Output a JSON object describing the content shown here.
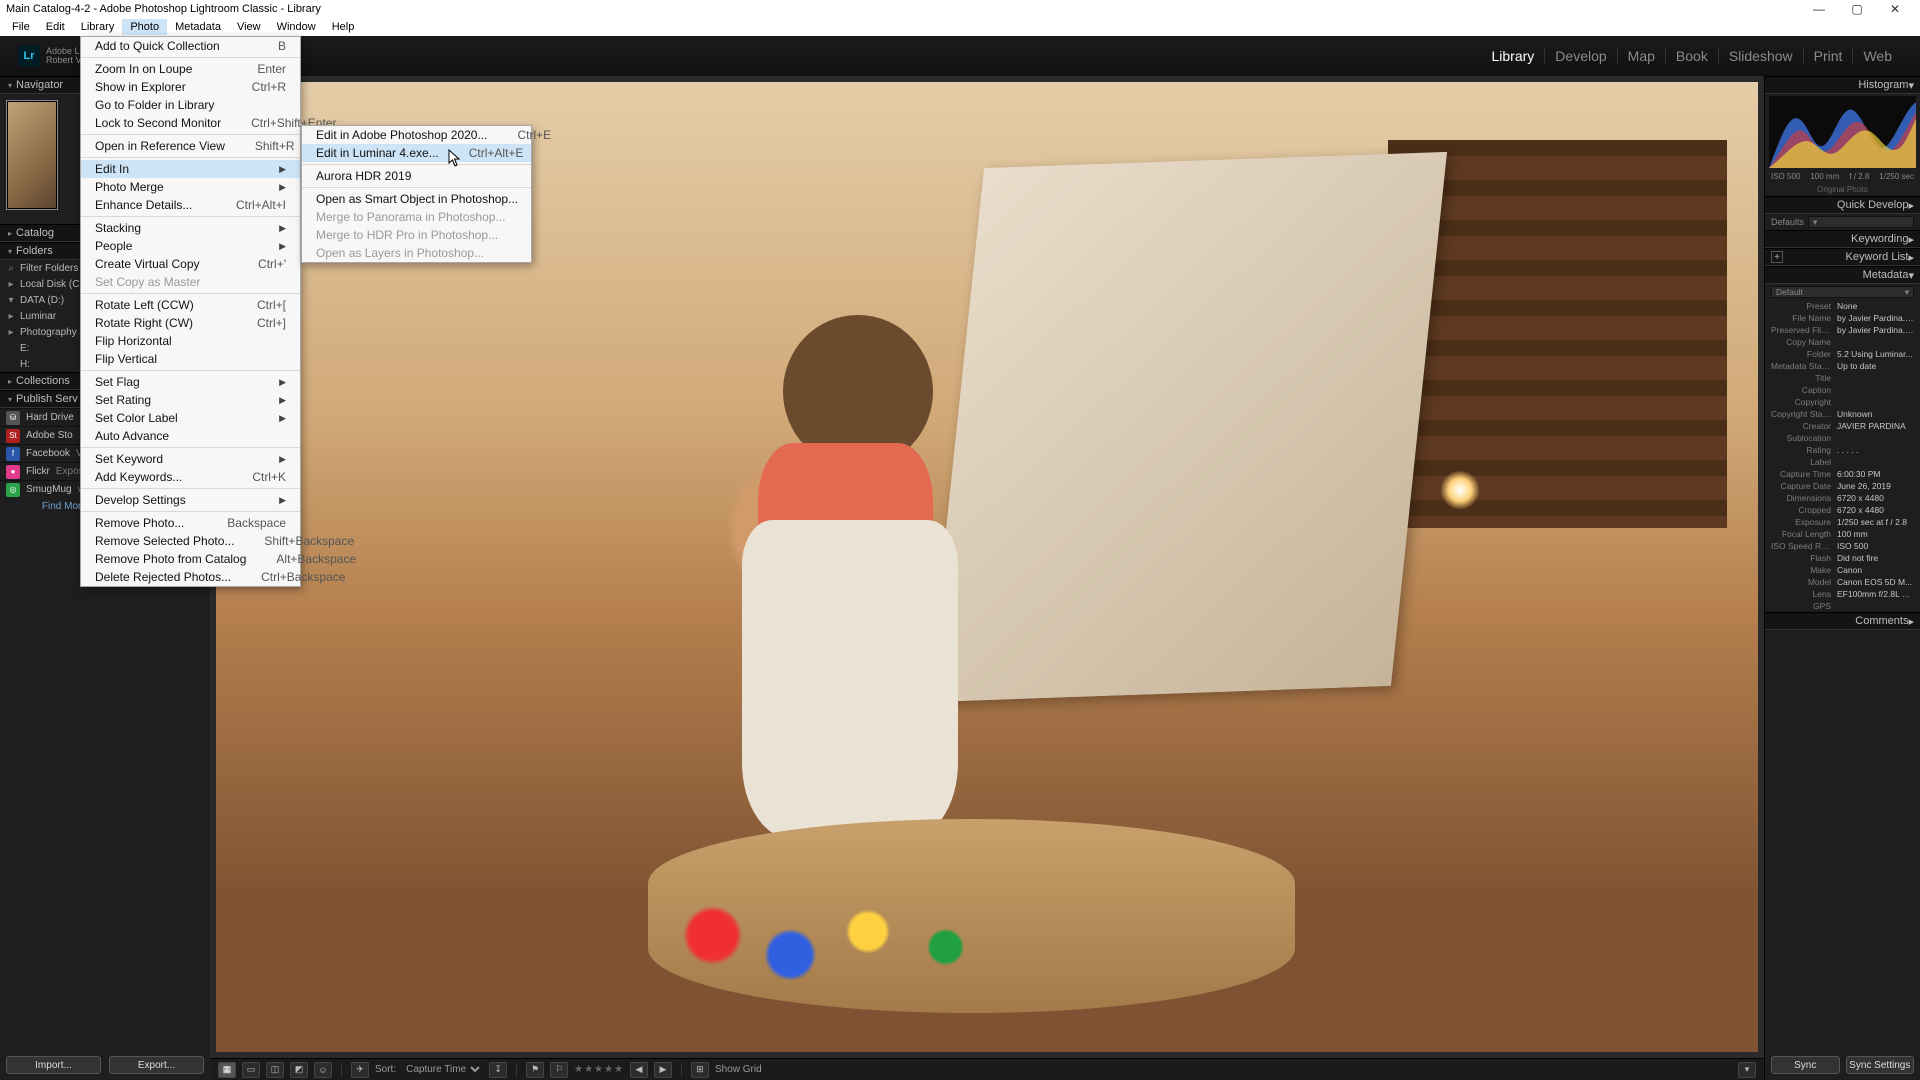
{
  "window": {
    "title": "Main Catalog-4-2 - Adobe Photoshop Lightroom Classic - Library"
  },
  "menubar": [
    "File",
    "Edit",
    "Library",
    "Photo",
    "Metadata",
    "View",
    "Window",
    "Help"
  ],
  "menubar_active_index": 3,
  "modulepicker": {
    "product_top": "Adobe Lightroom",
    "product_bottom": "Robert Va",
    "modules": [
      "Library",
      "Develop",
      "Map",
      "Book",
      "Slideshow",
      "Print",
      "Web"
    ],
    "active": "Library"
  },
  "left": {
    "navigator": {
      "title": "Navigator"
    },
    "catalog": {
      "title": "Catalog"
    },
    "folders": {
      "title": "Folders",
      "filter_label": "Filter Folders",
      "tree": [
        {
          "icon": "▸",
          "text": "Local Disk (C:"
        },
        {
          "icon": "▾",
          "text": "DATA (D:)"
        },
        {
          "icon": "▸",
          "text": "Luminar"
        },
        {
          "icon": "▸",
          "text": "Photography"
        },
        {
          "icon": "",
          "text": "E:"
        },
        {
          "icon": "",
          "text": "H:"
        }
      ]
    },
    "collections": {
      "title": "Collections"
    },
    "publish": {
      "title": "Publish Serv",
      "rows": [
        {
          "chip": "#555",
          "glyph": "⛁",
          "name": "Hard Drive",
          "detail": ""
        },
        {
          "chip": "#b02020",
          "glyph": "St",
          "name": "Adobe Sto",
          "detail": ""
        },
        {
          "chip": "#2956a8",
          "glyph": "f",
          "name": "Facebook",
          "detail": "Vanelli on Facebook",
          "arrow": true
        },
        {
          "chip": "#e23a8d",
          "glyph": "●",
          "name": "Flickr",
          "detail": "Exposure"
        },
        {
          "chip": "#2aa24a",
          "glyph": "◎",
          "name": "SmugMug",
          "detail": "vanelli",
          "arrow": true
        }
      ],
      "findmore": "Find More Services Online..."
    },
    "buttons": {
      "import": "Import...",
      "export": "Export..."
    }
  },
  "toolbar": {
    "sort_label": "Sort:",
    "sort_value": "Capture Time",
    "showgrid": "Show Grid"
  },
  "right": {
    "histogram": {
      "title": "Histogram",
      "iso": "ISO 500",
      "focal": "100 mm",
      "aperture": "f / 2.8",
      "shutter": "1/250 sec",
      "orig": "Original Photo"
    },
    "quickdevelop": {
      "title": "Quick Develop",
      "defaults": "Defaults"
    },
    "keywording": {
      "title": "Keywording"
    },
    "keywordlist": {
      "title": "Keyword List"
    },
    "metadata": {
      "title": "Metadata",
      "default": "Default",
      "rows": [
        {
          "k": "Preset",
          "v": "None"
        },
        {
          "k": "File Name",
          "v": "by Javier Pardina.CR2"
        },
        {
          "k": "Preserved File Name",
          "v": "by Javier Pardina.CR2"
        },
        {
          "k": "Copy Name",
          "v": ""
        },
        {
          "k": "Folder",
          "v": "5.2 Using Luminar..."
        },
        {
          "k": "Metadata Status",
          "v": "Up to date"
        },
        {
          "k": "Title",
          "v": ""
        },
        {
          "k": "Caption",
          "v": ""
        },
        {
          "k": "Copyright",
          "v": ""
        },
        {
          "k": "Copyright Status",
          "v": "Unknown"
        },
        {
          "k": "Creator",
          "v": "JAVIER PARDINA"
        },
        {
          "k": "Sublocation",
          "v": ""
        },
        {
          "k": "Rating",
          "v": ". . . . ."
        },
        {
          "k": "Label",
          "v": ""
        },
        {
          "k": "Capture Time",
          "v": "6:00:30 PM"
        },
        {
          "k": "Capture Date",
          "v": "June 26, 2019"
        },
        {
          "k": "Dimensions",
          "v": "6720 x 4480"
        },
        {
          "k": "Cropped",
          "v": "6720 x 4480"
        },
        {
          "k": "Exposure",
          "v": "1/250 sec at f / 2.8"
        },
        {
          "k": "Focal Length",
          "v": "100 mm"
        },
        {
          "k": "ISO Speed Rating",
          "v": "ISO 500"
        },
        {
          "k": "Flash",
          "v": "Did not fire"
        },
        {
          "k": "Make",
          "v": "Canon"
        },
        {
          "k": "Model",
          "v": "Canon EOS 5D M..."
        },
        {
          "k": "Lens",
          "v": "EF100mm f/2.8L M..."
        },
        {
          "k": "GPS",
          "v": ""
        }
      ]
    },
    "comments": {
      "title": "Comments"
    },
    "buttons": {
      "sync": "Sync",
      "settings": "Sync Settings"
    }
  },
  "photoMenu": [
    {
      "t": "item",
      "label": "Add to Quick Collection",
      "shortcut": "B"
    },
    {
      "t": "sep"
    },
    {
      "t": "item",
      "label": "Zoom In on Loupe",
      "shortcut": "Enter"
    },
    {
      "t": "item",
      "label": "Show in Explorer",
      "shortcut": "Ctrl+R"
    },
    {
      "t": "item",
      "label": "Go to Folder in Library"
    },
    {
      "t": "item",
      "label": "Lock to Second Monitor",
      "shortcut": "Ctrl+Shift+Enter"
    },
    {
      "t": "sep"
    },
    {
      "t": "item",
      "label": "Open in Reference View",
      "shortcut": "Shift+R"
    },
    {
      "t": "sep"
    },
    {
      "t": "item",
      "label": "Edit In",
      "sub": true,
      "sel": true
    },
    {
      "t": "item",
      "label": "Photo Merge",
      "sub": true
    },
    {
      "t": "item",
      "label": "Enhance Details...",
      "shortcut": "Ctrl+Alt+I"
    },
    {
      "t": "sep"
    },
    {
      "t": "item",
      "label": "Stacking",
      "sub": true
    },
    {
      "t": "item",
      "label": "People",
      "sub": true
    },
    {
      "t": "item",
      "label": "Create Virtual Copy",
      "shortcut": "Ctrl+'"
    },
    {
      "t": "item",
      "label": "Set Copy as Master",
      "dis": true
    },
    {
      "t": "sep"
    },
    {
      "t": "item",
      "label": "Rotate Left (CCW)",
      "shortcut": "Ctrl+["
    },
    {
      "t": "item",
      "label": "Rotate Right (CW)",
      "shortcut": "Ctrl+]"
    },
    {
      "t": "item",
      "label": "Flip Horizontal"
    },
    {
      "t": "item",
      "label": "Flip Vertical"
    },
    {
      "t": "sep"
    },
    {
      "t": "item",
      "label": "Set Flag",
      "sub": true
    },
    {
      "t": "item",
      "label": "Set Rating",
      "sub": true
    },
    {
      "t": "item",
      "label": "Set Color Label",
      "sub": true
    },
    {
      "t": "item",
      "label": "Auto Advance"
    },
    {
      "t": "sep"
    },
    {
      "t": "item",
      "label": "Set Keyword",
      "sub": true
    },
    {
      "t": "item",
      "label": "Add Keywords...",
      "shortcut": "Ctrl+K"
    },
    {
      "t": "sep"
    },
    {
      "t": "item",
      "label": "Develop Settings",
      "sub": true
    },
    {
      "t": "sep"
    },
    {
      "t": "item",
      "label": "Remove Photo...",
      "shortcut": "Backspace"
    },
    {
      "t": "item",
      "label": "Remove Selected Photo...",
      "shortcut": "Shift+Backspace"
    },
    {
      "t": "item",
      "label": "Remove Photo from Catalog",
      "shortcut": "Alt+Backspace"
    },
    {
      "t": "item",
      "label": "Delete Rejected Photos...",
      "shortcut": "Ctrl+Backspace"
    }
  ],
  "editInMenu": [
    {
      "t": "item",
      "label": "Edit in Adobe Photoshop 2020...",
      "shortcut": "Ctrl+E"
    },
    {
      "t": "item",
      "label": "Edit in Luminar 4.exe...",
      "shortcut": "Ctrl+Alt+E",
      "sel": true
    },
    {
      "t": "sep"
    },
    {
      "t": "item",
      "label": "Aurora HDR 2019"
    },
    {
      "t": "sep"
    },
    {
      "t": "item",
      "label": "Open as Smart Object in Photoshop..."
    },
    {
      "t": "item",
      "label": "Merge to Panorama in Photoshop...",
      "dis": true
    },
    {
      "t": "item",
      "label": "Merge to HDR Pro in Photoshop...",
      "dis": true
    },
    {
      "t": "item",
      "label": "Open as Layers in Photoshop...",
      "dis": true
    }
  ]
}
